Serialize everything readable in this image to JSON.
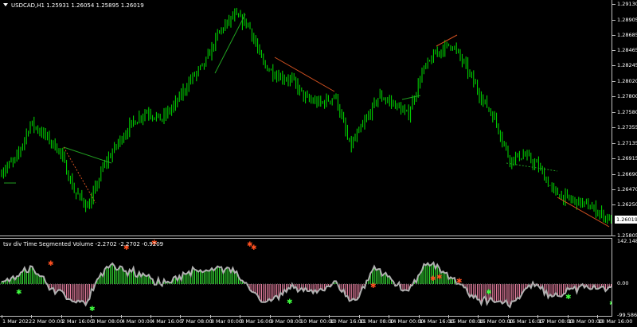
{
  "main_chart": {
    "title": "USDCAD,H1  1.25931 1.26054 1.25895 1.26019",
    "current_price": "1.26019",
    "price_axis": [
      "1.29130",
      "1.28905",
      "1.28685",
      "1.28465",
      "1.28245",
      "1.28020",
      "1.27800",
      "1.27580",
      "1.27355",
      "1.27135",
      "1.26915",
      "1.26690",
      "1.26470",
      "1.26250",
      "1.25805"
    ],
    "ylim": [
      1.25805,
      1.2913
    ],
    "candle_color": "#00e000",
    "price_path": [
      1.2673,
      1.269,
      1.2742,
      1.2724,
      1.2702,
      1.2644,
      1.2621,
      1.2679,
      1.2713,
      1.2742,
      1.2759,
      1.2747,
      1.277,
      1.2804,
      1.2827,
      1.2873,
      1.2896,
      1.2884,
      1.2827,
      1.281,
      1.2804,
      1.2776,
      1.277,
      1.2781,
      1.2707,
      1.2742,
      1.2781,
      1.277,
      1.2753,
      1.2816,
      1.2844,
      1.2856,
      1.2822,
      1.2781,
      1.2747,
      1.269,
      1.2696,
      1.2679,
      1.2644,
      1.2633,
      1.2627,
      1.2616,
      1.2602
    ]
  },
  "indicator": {
    "title": "tsv div Time Segmented Volume -2.2702 -2.2702 -0.9209",
    "axis": {
      "max": "142.1487",
      "zero": "0.00",
      "min": "-99.5865"
    },
    "positive_color": "#33dd33",
    "negative_color": "#e87fa0",
    "line_color": "#b0b0b0"
  },
  "time_axis": [
    "1 Mar 2022",
    "2 Mar 00:00",
    "2 Mar 16:00",
    "3 Mar 08:00",
    "4 Mar 00:00",
    "4 Mar 16:00",
    "7 Mar 08:00",
    "8 Mar 00:00",
    "8 Mar 16:00",
    "9 Mar 08:00",
    "10 Mar 00:00",
    "10 Mar 16:00",
    "11 Mar 08:00",
    "14 Mar 00:00",
    "14 Mar 16:00",
    "15 Mar 08:00",
    "16 Mar 00:00",
    "16 Mar 16:00",
    "17 Mar 08:00",
    "18 Mar 00:00",
    "18 Mar 16:00"
  ]
}
